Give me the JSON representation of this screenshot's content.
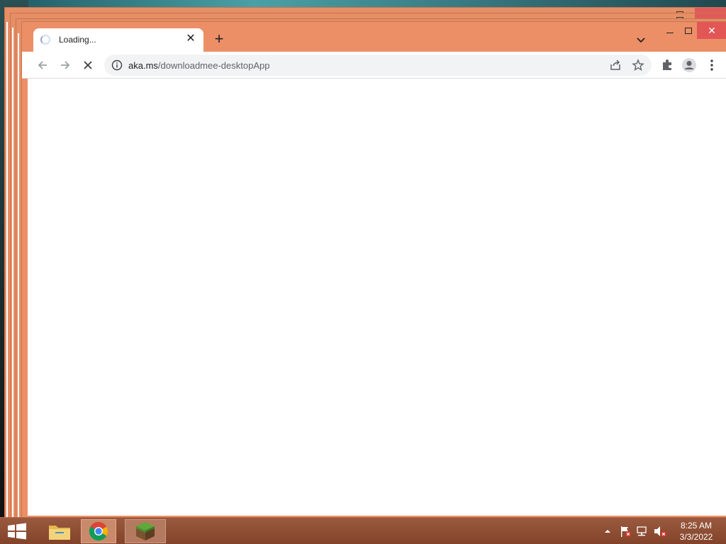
{
  "browser": {
    "tab": {
      "title": "Loading...",
      "close_glyph": "✕"
    },
    "new_tab_glyph": "+",
    "window_controls": {
      "close_glyph": "✕"
    },
    "address_bar": {
      "host": "aka.ms",
      "path": "/downloadmee-desktopApp"
    },
    "icons": {
      "back": "arrow-left-icon",
      "forward": "arrow-right-icon",
      "stop": "stop-loading-icon",
      "info": "info-icon",
      "share": "share-icon",
      "bookmark": "star-icon",
      "extensions": "puzzle-icon",
      "profile": "profile-icon",
      "menu": "kebab-menu-icon",
      "tab_search": "chevron-down-icon"
    }
  },
  "taskbar": {
    "apps": [
      "file-explorer",
      "google-chrome",
      "minecraft"
    ],
    "clock": {
      "time": "8:25 AM",
      "date": "3/3/2022"
    }
  },
  "colors": {
    "window_frame": "#ec8f67",
    "close_button": "#e35656",
    "taskbar": "#8d4c33"
  }
}
